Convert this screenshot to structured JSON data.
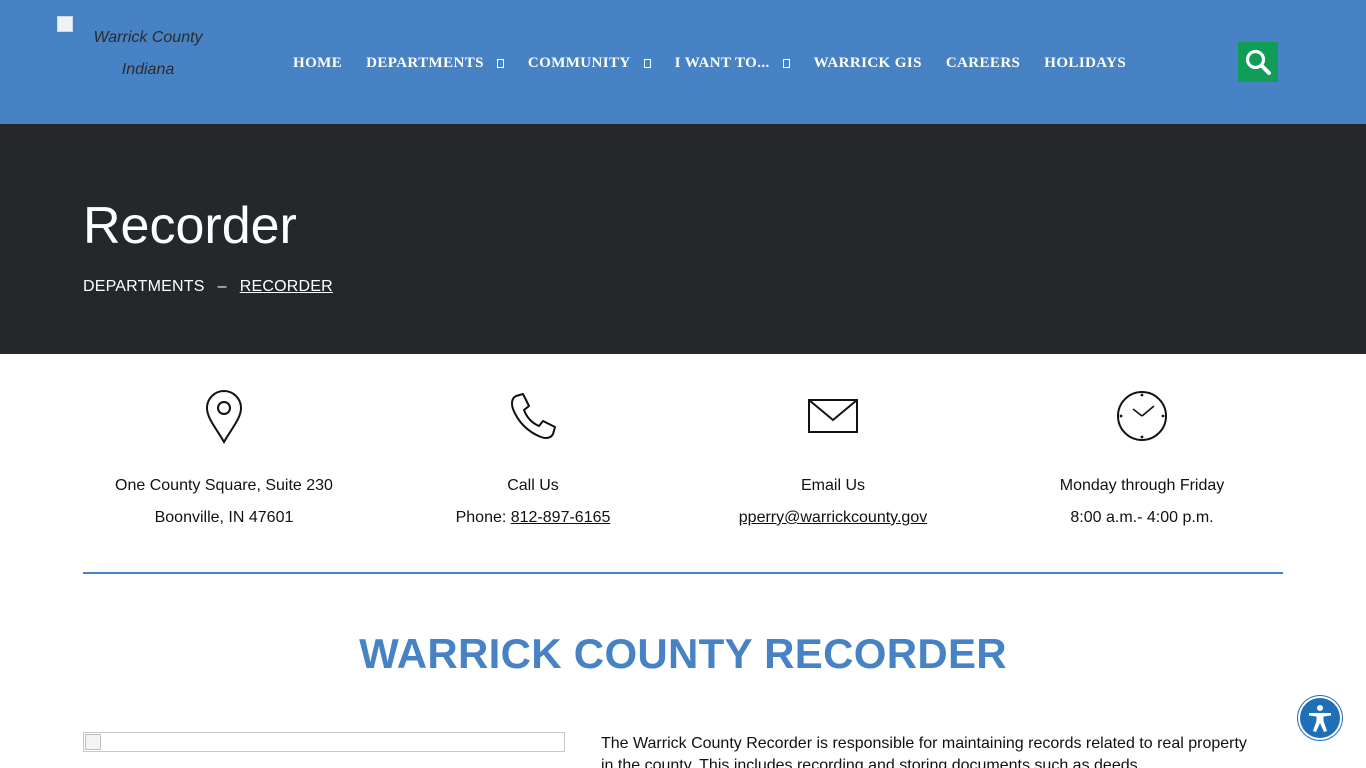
{
  "header": {
    "logo_alt_line1": "Warrick County",
    "logo_alt_line2": "Indiana",
    "nav": [
      {
        "label": "HOME"
      },
      {
        "label": "DEPARTMENTS"
      },
      {
        "label": "COMMUNITY"
      },
      {
        "label": "I WANT TO..."
      },
      {
        "label": "WARRICK GIS"
      },
      {
        "label": "CAREERS"
      },
      {
        "label": "HOLIDAYS"
      }
    ],
    "search_icon": "search-icon",
    "color": "#4682c4",
    "search_color": "#0f9d58"
  },
  "hero": {
    "title": "Recorder",
    "breadcrumb": {
      "parent": "DEPARTMENTS",
      "separator": "–",
      "current": "RECORDER"
    },
    "background": "#25282b"
  },
  "info": {
    "address": {
      "icon": "map-pin-icon",
      "line1": "One County Square, Suite 230",
      "line2": "Boonville, IN 47601"
    },
    "phone": {
      "icon": "phone-icon",
      "line1": "Call Us",
      "prefix": "Phone: ",
      "number": "812-897-6165"
    },
    "email": {
      "icon": "envelope-icon",
      "line1": "Email Us",
      "address": "pperry@warrickcounty.gov"
    },
    "hours": {
      "icon": "clock-icon",
      "line1": "Monday through Friday",
      "line2": "8:00 a.m.- 4:00 p.m."
    }
  },
  "main": {
    "section_title": "WARRICK COUNTY RECORDER",
    "body_text": "The Warrick County Recorder is responsible for maintaining records related to real property in the county. This includes recording and storing documents such as deeds,"
  },
  "accessibility": {
    "icon": "accessibility-icon",
    "color": "#1f6fb8"
  }
}
